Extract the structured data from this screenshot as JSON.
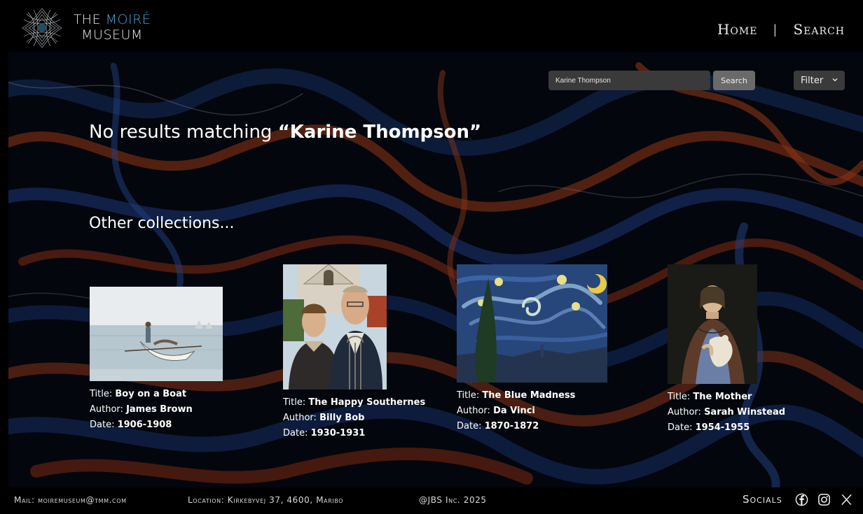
{
  "header": {
    "logo_line1_prefix": "THE",
    "logo_line1_accent": "MOIRÉ",
    "logo_line2": "MUSEUM",
    "nav": {
      "home": "Home",
      "separator": "|",
      "search": "Search"
    }
  },
  "search": {
    "value": "Karine Thompson",
    "button_label": "Search",
    "filter_label": "Filter"
  },
  "results": {
    "no_results_prefix": "No results matching",
    "query_display": "“Karine Thompson”"
  },
  "collections": {
    "title": "Other collections...",
    "title_label": "Title:",
    "author_label": "Author:",
    "date_label": "Date:",
    "items": [
      {
        "title": "Boy on a Boat",
        "author": "James Brown",
        "date": "1906-1908"
      },
      {
        "title": "The Happy Southernes",
        "author": "Billy Bob",
        "date": "1930-1931"
      },
      {
        "title": "The Blue Madness",
        "author": "Da Vinci",
        "date": "1870-1872"
      },
      {
        "title": "The Mother",
        "author": "Sarah Winstead",
        "date": "1954-1955"
      }
    ]
  },
  "footer": {
    "mail": "Mail: moiremuseum@tmm.com",
    "location": "Location: Kirkebyvej 37, 4600, Maribo",
    "copyright": "@JBS Inc. 2025",
    "socials_label": "Socials"
  },
  "colors": {
    "accent": "#4aa7d8",
    "background": "#000000",
    "input_bg": "#3a3a3a",
    "button_bg": "#6a6a6a"
  },
  "icons": [
    "moire-logo-icon",
    "chevron-down-icon",
    "facebook-icon",
    "instagram-icon",
    "x-icon"
  ]
}
